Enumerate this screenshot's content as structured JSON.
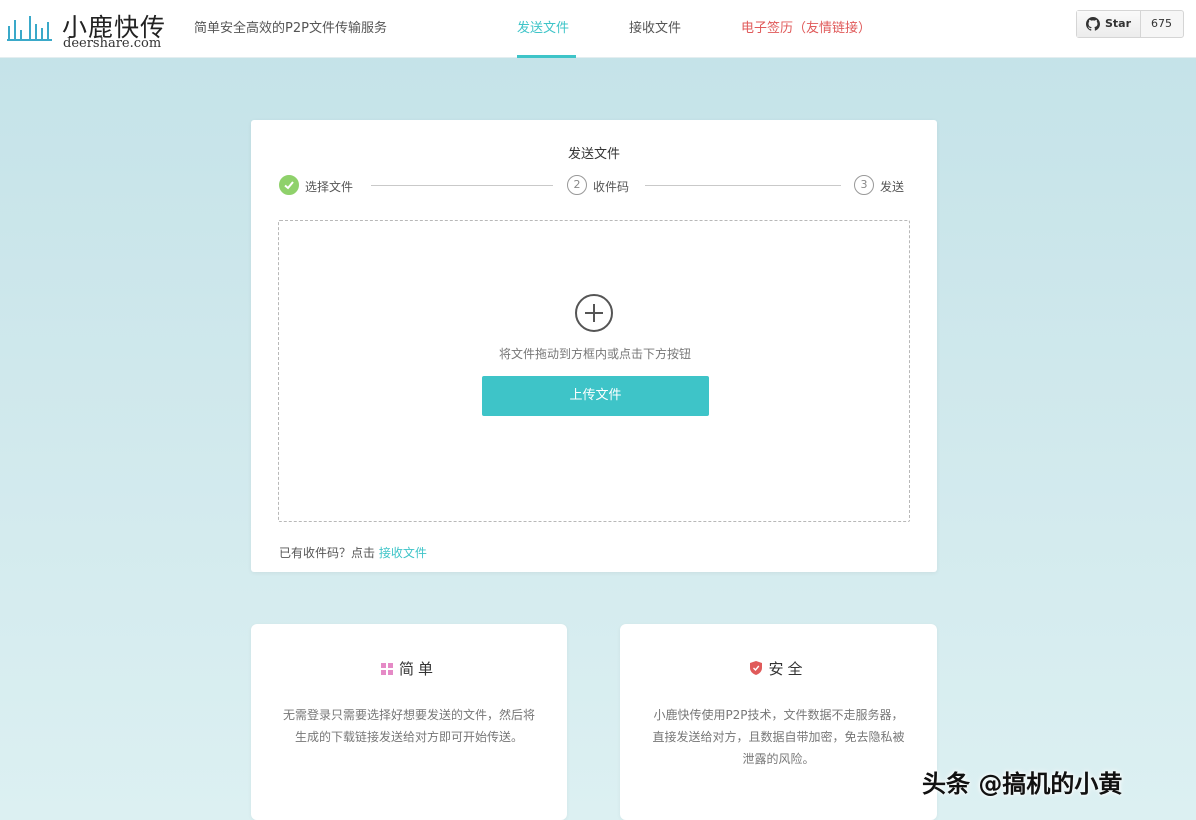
{
  "header": {
    "logo_title": "小鹿快传",
    "logo_sub": "deershare.com",
    "tagline": "简单安全高效的P2P文件传输服务",
    "nav": [
      {
        "label": "发送文件",
        "active": true
      },
      {
        "label": "接收文件",
        "active": false
      },
      {
        "label": "电子签历（友情链接）",
        "active": false
      }
    ],
    "github": {
      "star_label": "Star",
      "count": "675"
    }
  },
  "send_card": {
    "title": "发送文件",
    "steps": [
      {
        "num": "1",
        "label": "选择文件",
        "done": true
      },
      {
        "num": "2",
        "label": "收件码",
        "done": false
      },
      {
        "num": "3",
        "label": "发送",
        "done": false
      }
    ],
    "drop_hint": "将文件拖动到方框内或点击下方按钮",
    "upload_label": "上传文件",
    "have_code_text": "已有收件码？点击",
    "receive_link": "接收文件"
  },
  "features": [
    {
      "title": "简单",
      "icon": "grid-icon",
      "icon_color": "#e58ac6",
      "text": "无需登录只需要选择好想要发送的文件，然后将生成的下载链接发送给对方即可开始传送。"
    },
    {
      "title": "安全",
      "icon": "shield-icon",
      "icon_color": "#e05a5a",
      "text": "小鹿快传使用P2P技术，文件数据不走服务器，直接发送给对方，且数据自带加密，免去隐私被泄露的风险。"
    }
  ],
  "watermark": "头条 @搞机的小黄",
  "colors": {
    "accent": "#3ec4c8",
    "done": "#8fd16b",
    "link_red": "#e05a5a"
  }
}
